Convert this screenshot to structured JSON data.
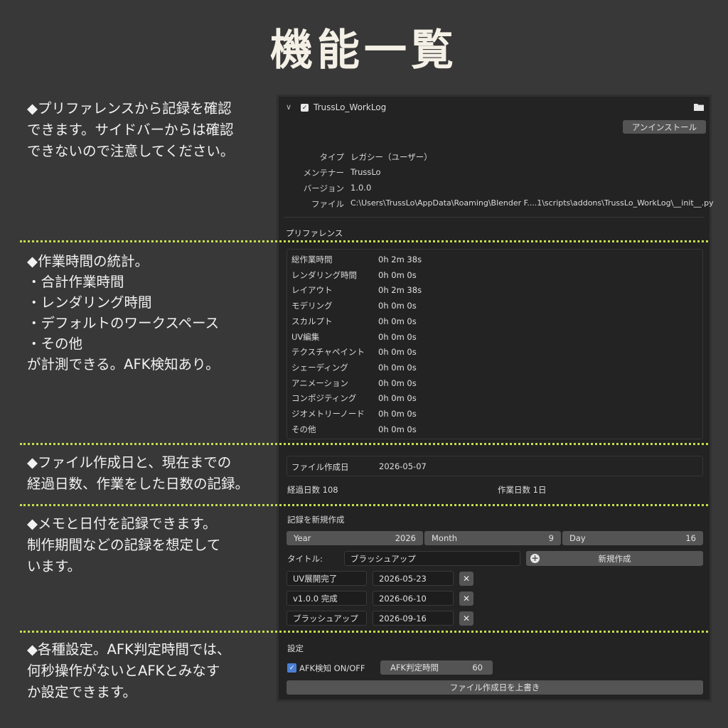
{
  "page_title": "機能一覧",
  "notes": [
    "◆プリファレンスから記録を確認\nできます。サイドバーからは確認\nできないので注意してください。",
    "◆作業時間の統計。\n・合計作業時間\n・レンダリング時間\n・デフォルトのワークスペース\n・その他\nが計測できる。AFK検知あり。",
    "◆ファイル作成日と、現在までの\n経過日数、作業をした日数の記録。",
    "◆メモと日付を記録できます。\n制作期間などの記録を想定して\nいます。",
    "◆各種設定。AFK判定時間では、\n何秒操作がないとAFKとみなす\nか設定できます。"
  ],
  "addon": {
    "name": "TrussLo_WorkLog",
    "uninstall_label": "アンインストール",
    "info": [
      {
        "label": "タイプ",
        "value": "レガシー（ユーザー）"
      },
      {
        "label": "メンテナー",
        "value": "TrussLo"
      },
      {
        "label": "バージョン",
        "value": "1.0.0"
      },
      {
        "label": "ファイル",
        "value": "C:\\Users\\TrussLo\\AppData\\Roaming\\Blender F....1\\scripts\\addons\\TrussLo_WorkLog\\__init__.py"
      }
    ]
  },
  "preferences": {
    "heading": "プリファレンス",
    "stats": [
      {
        "label": "総作業時間",
        "value": "0h 2m 38s"
      },
      {
        "label": "レンダリング時間",
        "value": "0h 0m 0s"
      },
      {
        "label": "レイアウト",
        "value": "0h 2m 38s"
      },
      {
        "label": "モデリング",
        "value": "0h 0m 0s"
      },
      {
        "label": "スカルプト",
        "value": "0h 0m 0s"
      },
      {
        "label": "UV編集",
        "value": "0h 0m 0s"
      },
      {
        "label": "テクスチャペイント",
        "value": "0h 0m 0s"
      },
      {
        "label": "シェーディング",
        "value": "0h 0m 0s"
      },
      {
        "label": "アニメーション",
        "value": "0h 0m 0s"
      },
      {
        "label": "コンポジティング",
        "value": "0h 0m 0s"
      },
      {
        "label": "ジオメトリーノード",
        "value": "0h 0m 0s"
      },
      {
        "label": "その他",
        "value": "0h 0m 0s"
      }
    ],
    "file_created_label": "ファイル作成日",
    "file_created_value": "2026-05-07",
    "elapsed_days": "経過日数 108",
    "work_days": "作業日数 1日"
  },
  "new_record": {
    "heading": "記録を新規作成",
    "year_label": "Year",
    "year_value": "2026",
    "month_label": "Month",
    "month_value": "9",
    "day_label": "Day",
    "day_value": "16",
    "title_label": "タイトル:",
    "title_value": "ブラッシュアップ",
    "create_button": "新規作成",
    "records": [
      {
        "title": "UV展開完了",
        "date": "2026-05-23"
      },
      {
        "title": "v1.0.0 完成",
        "date": "2026-06-10"
      },
      {
        "title": "ブラッシュアップ",
        "date": "2026-09-16"
      }
    ],
    "delete_glyph": "✕"
  },
  "settings": {
    "heading": "設定",
    "afk_toggle_label": "AFK検知 ON/OFF",
    "afk_toggle_checked": true,
    "afk_time_label": "AFK判定時間",
    "afk_time_value": "60",
    "overwrite_button": "ファイル作成日を上書き"
  },
  "colors": {
    "background": "#383838",
    "panel": "#232323",
    "divider": "#c8dc4a",
    "accent_checkbox": "#4a7fd4"
  }
}
